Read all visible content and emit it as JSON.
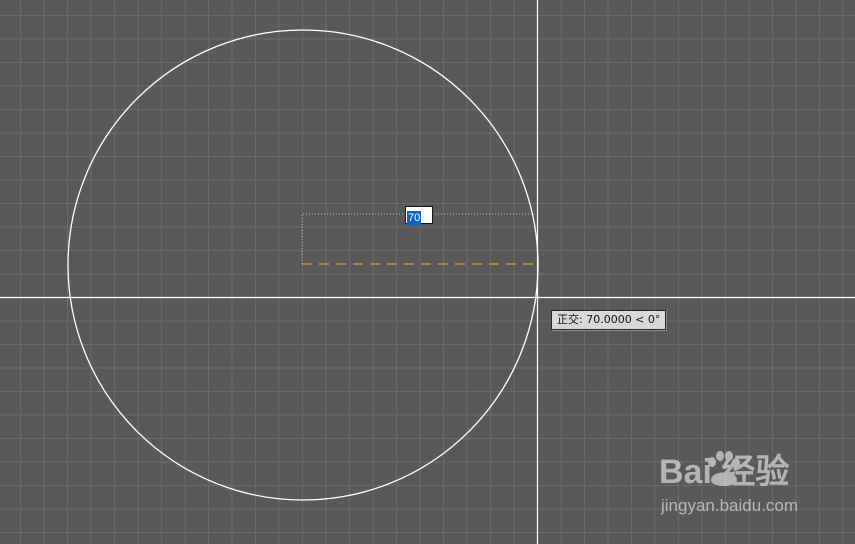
{
  "viewport": {
    "background": "#595959",
    "grid_color": "#6a6a6a",
    "crosshair_color": "#ffffff",
    "circle_color": "#ffffff",
    "extension_line_color": "#e0a020"
  },
  "dynamic_input": {
    "value": "70"
  },
  "tooltip": {
    "text": "正交: 70.0000 < 0°"
  },
  "watermark": {
    "brand": "Bai  经验",
    "url": "jingyan.baidu.com"
  }
}
